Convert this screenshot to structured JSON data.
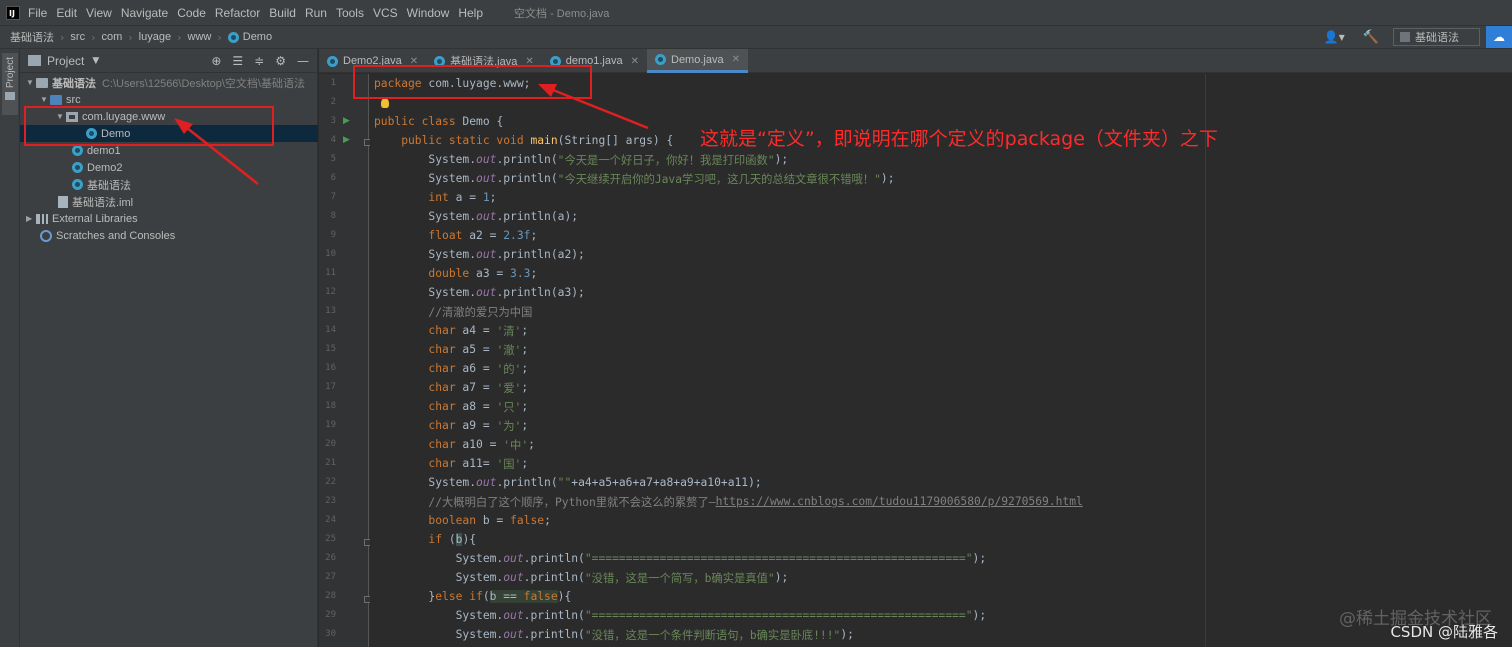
{
  "menubar": {
    "logo": "IJ",
    "items": [
      "File",
      "Edit",
      "View",
      "Navigate",
      "Code",
      "Refactor",
      "Build",
      "Run",
      "Tools",
      "VCS",
      "Window",
      "Help"
    ],
    "window_title": "空文档 - Demo.java"
  },
  "breadcrumb": [
    "基础语法",
    "src",
    "com",
    "luyage",
    "www",
    "Demo"
  ],
  "toolbar": {
    "run_config": "基础语法"
  },
  "left_stripe": {
    "project_tab": "Project"
  },
  "project_panel": {
    "title": "Project",
    "tree": [
      {
        "label": "基础语法",
        "path": "C:\\Users\\12566\\Desktop\\空文档\\基础语法",
        "icon": "folder-icon"
      },
      {
        "label": "src",
        "icon": "source-folder-icon"
      },
      {
        "label": "com.luyage.www",
        "icon": "package-icon"
      },
      {
        "label": "Demo",
        "icon": "java-class-icon"
      },
      {
        "label": "demo1",
        "icon": "java-class-icon"
      },
      {
        "label": "Demo2",
        "icon": "java-class-icon"
      },
      {
        "label": "基础语法",
        "icon": "java-class-icon"
      },
      {
        "label": "基础语法.iml",
        "icon": "iml-file-icon"
      },
      {
        "label": "External Libraries",
        "icon": "library-icon"
      },
      {
        "label": "Scratches and Consoles",
        "icon": "scratches-icon"
      }
    ]
  },
  "editor_tabs": [
    "Demo2.java",
    "基础语法.java",
    "demo1.java",
    "Demo.java"
  ],
  "line_numbers": [
    "1",
    "2",
    "3",
    "4",
    "5",
    "6",
    "7",
    "8",
    "9",
    "10",
    "11",
    "12",
    "13",
    "14",
    "15",
    "16",
    "17",
    "18",
    "19",
    "20",
    "21",
    "22",
    "23",
    "24",
    "25",
    "26",
    "27",
    "28",
    "29",
    "30"
  ],
  "code": {
    "l1_kw": "package",
    "l1_rest": " com.luyage.www;",
    "l3_kw": "public class",
    "l3_name": " Demo",
    "l3_rest": " {",
    "l4_kw": "    public static void",
    "l4_fn": " main",
    "l4_rest": "(String[] args) {",
    "l5_a": "        System.",
    "l5_out": "out",
    "l5_b": ".println(",
    "l5_str": "\"今天是一个好日子，你好！我是打印函数\"",
    "l5_c": ");",
    "l6_a": "        System.",
    "l6_out": "out",
    "l6_b": ".println(",
    "l6_str": "\"今天继续开启你的Java学习吧，这几天的总结文章很不错哦！\"",
    "l6_c": ");",
    "l7_kw": "        int",
    "l7_a": " a = ",
    "l7_num": "1",
    "l7_b": ";",
    "l8_a": "        System.",
    "l8_out": "out",
    "l8_b": ".println(a);",
    "l9_kw": "        float",
    "l9_a": " a2 = ",
    "l9_num": "2.3f",
    "l9_b": ";",
    "l10_a": "        System.",
    "l10_out": "out",
    "l10_b": ".println(a2);",
    "l11_kw": "        double",
    "l11_a": " a3 = ",
    "l11_num": "3.3",
    "l11_b": ";",
    "l12_a": "        System.",
    "l12_out": "out",
    "l12_b": ".println(a3);",
    "l13_cmt": "        //清澈的爱只为中国",
    "l14_kw": "        char",
    "l14_a": " a4 = ",
    "l14_str": "'清'",
    "l14_b": ";",
    "l15_kw": "        char",
    "l15_a": " a5 = ",
    "l15_str": "'澈'",
    "l15_b": ";",
    "l16_kw": "        char",
    "l16_a": " a6 = ",
    "l16_str": "'的'",
    "l16_b": ";",
    "l17_kw": "        char",
    "l17_a": " a7 = ",
    "l17_str": "'爱'",
    "l17_b": ";",
    "l18_kw": "        char",
    "l18_a": " a8 = ",
    "l18_str": "'只'",
    "l18_b": ";",
    "l19_kw": "        char",
    "l19_a": " a9 = ",
    "l19_str": "'为'",
    "l19_b": ";",
    "l20_kw": "        char",
    "l20_a": " a10 = ",
    "l20_str": "'中'",
    "l20_b": ";",
    "l21_kw": "        char",
    "l21_a": " a11= ",
    "l21_str": "'国'",
    "l21_b": ";",
    "l22_a": "        System.",
    "l22_out": "out",
    "l22_b": ".println(",
    "l22_str": "\"\"",
    "l22_c": "+a4+a5+a6+a7+a8+a9+a10+a11);",
    "l23_cmt": "        //大概明白了这个顺序，Python里就不会这么的累赘了—",
    "l23_url": "https://www.cnblogs.com/tudou1179006580/p/9270569.html",
    "l24_kw": "        boolean",
    "l24_a": " b = ",
    "l24_kw2": "false",
    "l24_b": ";",
    "l25_kw": "        if",
    "l25_a": " (",
    "l25_hl": "b",
    "l25_b": "){",
    "l26_a": "            System.",
    "l26_out": "out",
    "l26_b": ".println(",
    "l26_str": "\"=======================================================\"",
    "l26_c": ");",
    "l27_a": "            System.",
    "l27_out": "out",
    "l27_b": ".println(",
    "l27_str": "\"没错，这是一个简写，b确实是真值\"",
    "l27_c": ");",
    "l28_a": "        }",
    "l28_kw": "else if",
    "l28_b": "(",
    "l28_hl": "b == ",
    "l28_kw2": "false",
    "l28_c": "){",
    "l29_a": "            System.",
    "l29_out": "out",
    "l29_b": ".println(",
    "l29_str": "\"=======================================================\"",
    "l29_c": ");",
    "l30_a": "            System.",
    "l30_out": "out",
    "l30_b": ".println(",
    "l30_str": "\"没错，这是一个条件判断语句，b确实是卧底!!!\"",
    "l30_c": ");"
  },
  "annotation": {
    "text": "这就是“定义”，即说明在哪个定义的package（文件夹）之下"
  },
  "watermarks": {
    "juejin": "@稀土掘金技术社区",
    "csdn": "CSDN @陆雅各"
  },
  "colors": {
    "annotation": "#e02020",
    "keyword": "#cc7832",
    "string": "#6a8759",
    "selection": "#0d293e"
  }
}
